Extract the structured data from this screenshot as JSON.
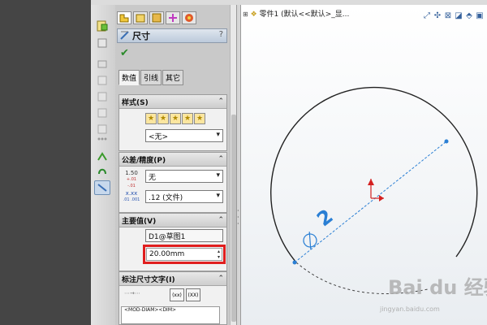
{
  "property_manager": {
    "title": "尺寸",
    "help_label": "?",
    "tabs": [
      "数值",
      "引线",
      "其它"
    ],
    "styles_group": {
      "header": "样式(S)",
      "collapse": "⌃",
      "style_select": "<无>"
    },
    "tolerance_group": {
      "header": "公差/精度(P)",
      "collapse": "⌃",
      "tolerance_type": "无",
      "precision": ".12 (文件)",
      "tol_icon_label": "1.50",
      "tol_icon_sub": "+.01 -.01",
      "prec_icon_label": "x.xx",
      "prec_icon_sub": ".01 .001"
    },
    "primary_value_group": {
      "header": "主要值(V)",
      "collapse": "⌃",
      "dimension_name": "D1@草图1",
      "value": "20.00mm"
    },
    "dim_text_group": {
      "header": "标注尺寸文字(I)",
      "collapse": "⌃",
      "xx_button_1": "(xx)",
      "xx_button_2": "(XX)",
      "text_value": "<MOD-DIAM><DIM>"
    }
  },
  "viewport": {
    "feature_tree_item": "零件1 (默认<<默认>_显...",
    "dimension_text": "2"
  },
  "watermark": {
    "text": "Bai du 经验",
    "sub": "jingyan.baidu.com"
  },
  "colors": {
    "highlight_box": "#e01e1e",
    "dimension_line": "#2a7fd4",
    "origin_arrow": "#d42020"
  }
}
